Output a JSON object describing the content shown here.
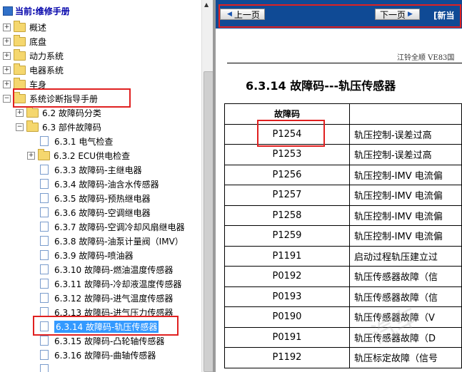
{
  "tree": {
    "header": "当前:维修手册",
    "nodes": [
      {
        "label": "概述",
        "pm": "+"
      },
      {
        "label": "底盘",
        "pm": "+"
      },
      {
        "label": "动力系统",
        "pm": "+"
      },
      {
        "label": "电器系统",
        "pm": "+"
      },
      {
        "label": "车身",
        "pm": "+"
      },
      {
        "label": "系统诊断指导手册",
        "pm": "−"
      },
      {
        "label": "6.2 故障码分类",
        "pm": "+"
      },
      {
        "label": "6.3 部件故障码",
        "pm": "−"
      },
      {
        "label": "6.3.1 电气检查"
      },
      {
        "label": "6.3.2 ECU供电检查",
        "pm": "+"
      },
      {
        "label": "6.3.3 故障码-主继电器"
      },
      {
        "label": "6.3.4 故障码-油含水传感器"
      },
      {
        "label": "6.3.5 故障码-预热继电器"
      },
      {
        "label": "6.3.6 故障码-空调继电器"
      },
      {
        "label": "6.3.7 故障码-空调冷却风扇继电器"
      },
      {
        "label": "6.3.8 故障码-油泵计量阀（IMV）"
      },
      {
        "label": "6.3.9 故障码-喷油器"
      },
      {
        "label": "6.3.10 故障码-燃油温度传感器"
      },
      {
        "label": "6.3.11 故障码-冷却液温度传感器"
      },
      {
        "label": "6.3.12 故障码-进气温度传感器"
      },
      {
        "label": "6.3.13 故障码-进气压力传感器"
      },
      {
        "label": "6.3.14 故障码-轨压传感器"
      },
      {
        "label": "6.3.15 故障码-凸轮轴传感器"
      },
      {
        "label": "6.3.16 故障码-曲轴传感器"
      },
      {
        "label": ""
      }
    ]
  },
  "nav": {
    "prev": "上一页",
    "next": "下一页",
    "title": "[新当"
  },
  "doc": {
    "brand": "江铃全顺 VE83国",
    "section_title": "6.3.14   故障码---轨压传感器",
    "table_header": [
      "故障码",
      ""
    ],
    "rows": [
      {
        "code": "P1254",
        "desc": "轨压控制-误差过高"
      },
      {
        "code": "P1253",
        "desc": "轨压控制-误差过高"
      },
      {
        "code": "P1256",
        "desc": "轨压控制-IMV 电流偏"
      },
      {
        "code": "P1257",
        "desc": "轨压控制-IMV 电流偏"
      },
      {
        "code": "P1258",
        "desc": "轨压控制-IMV 电流偏"
      },
      {
        "code": "P1259",
        "desc": "轨压控制-IMV 电流偏"
      },
      {
        "code": "P1191",
        "desc": "启动过程轨压建立过"
      },
      {
        "code": "P0192",
        "desc": "轨压传感器故障（信"
      },
      {
        "code": "P0193",
        "desc": "轨压传感器故障（信"
      },
      {
        "code": "P0190",
        "desc": "轨压传感器故障（V"
      },
      {
        "code": "P0191",
        "desc": "轨压传感器故障（D"
      },
      {
        "code": "P1192",
        "desc": "轨压标定故障（信号"
      }
    ]
  },
  "watermark": "汽车"
}
